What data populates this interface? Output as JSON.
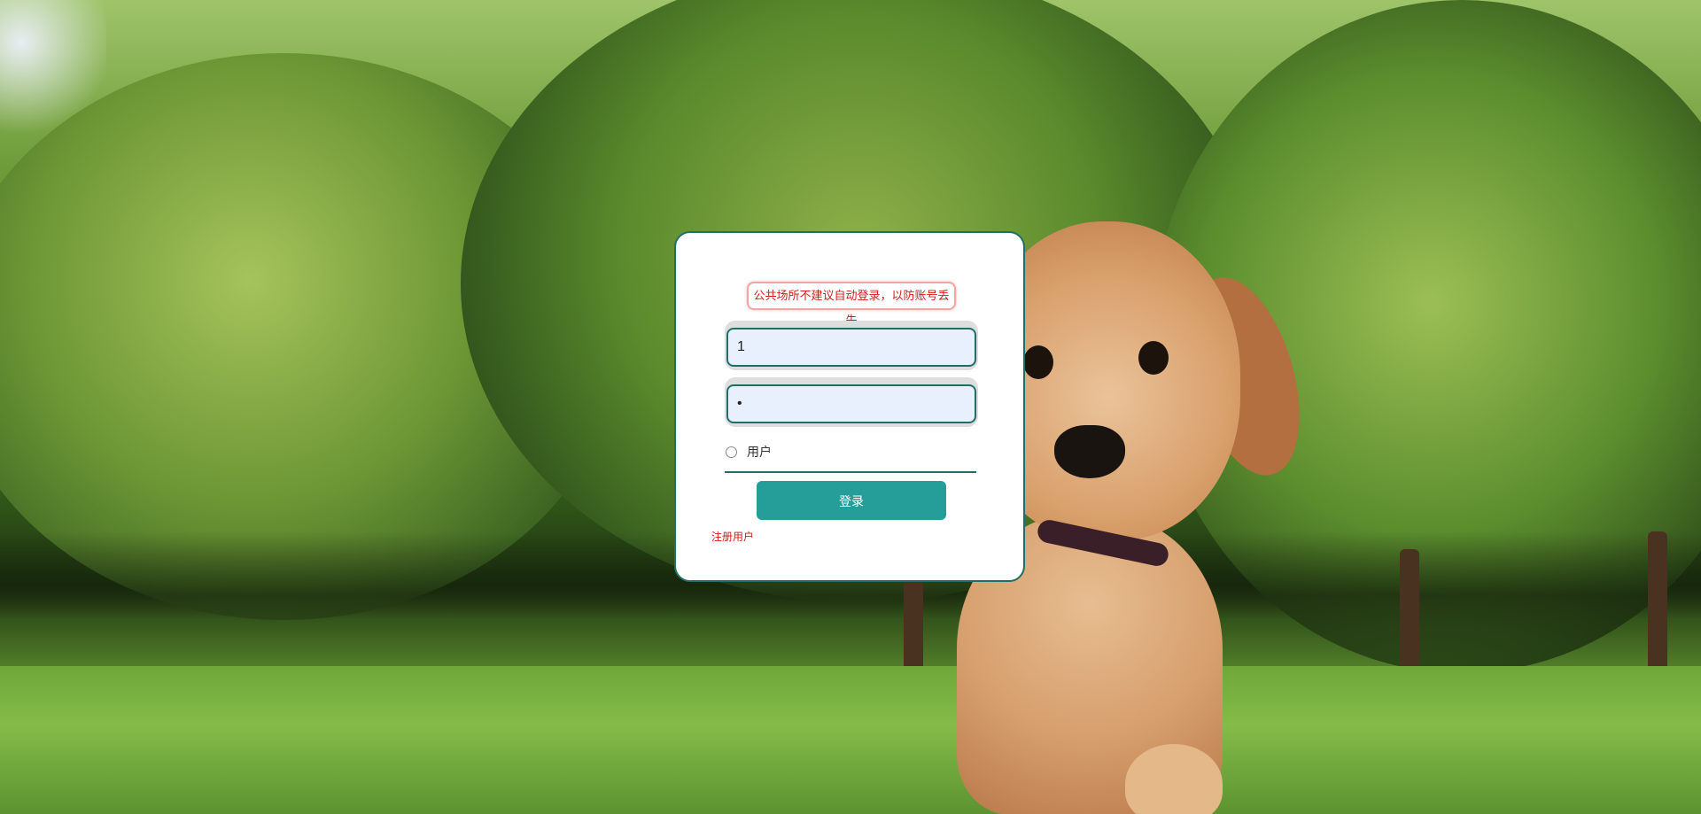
{
  "notice": "公共场所不建议自动登录，以防账号丢失",
  "form": {
    "username_value": "1",
    "password_value": "•",
    "role_label": "用户",
    "role_checked": false,
    "login_label": "登录",
    "register_label": "注册用户"
  },
  "colors": {
    "card_border": "#1f6f66",
    "login_button": "#259d98",
    "notice_text": "#d41c1c",
    "input_fill": "#e8f0fe"
  },
  "background": {
    "subject": "golden-retriever-puppy-on-grass-photo"
  }
}
